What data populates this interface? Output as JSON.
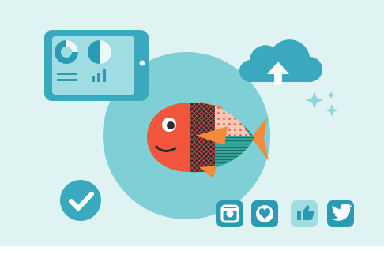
{
  "scene": {
    "description_hidden": "",
    "colors": {
      "background": "#dff3f2",
      "big_circle": "#7fcfd6",
      "teal": "#3aa9bf",
      "teal_dark": "#2a9bb3",
      "fish_red": "#f1553e",
      "fish_dark": "#2a2a33",
      "fish_orange": "#f68a3c",
      "fish_teal": "#35a79a"
    },
    "tablet": {
      "icons": [
        "donut-chart-icon",
        "pie-chart-icon",
        "bar-chart-icon"
      ]
    },
    "cloud": {
      "icon": "cloud-upload-icon"
    },
    "badges": [
      {
        "name": "check-icon"
      },
      {
        "name": "instagram-icon"
      },
      {
        "name": "heart-icon"
      },
      {
        "name": "thumbs-up-icon"
      },
      {
        "name": "twitter-icon"
      }
    ]
  }
}
